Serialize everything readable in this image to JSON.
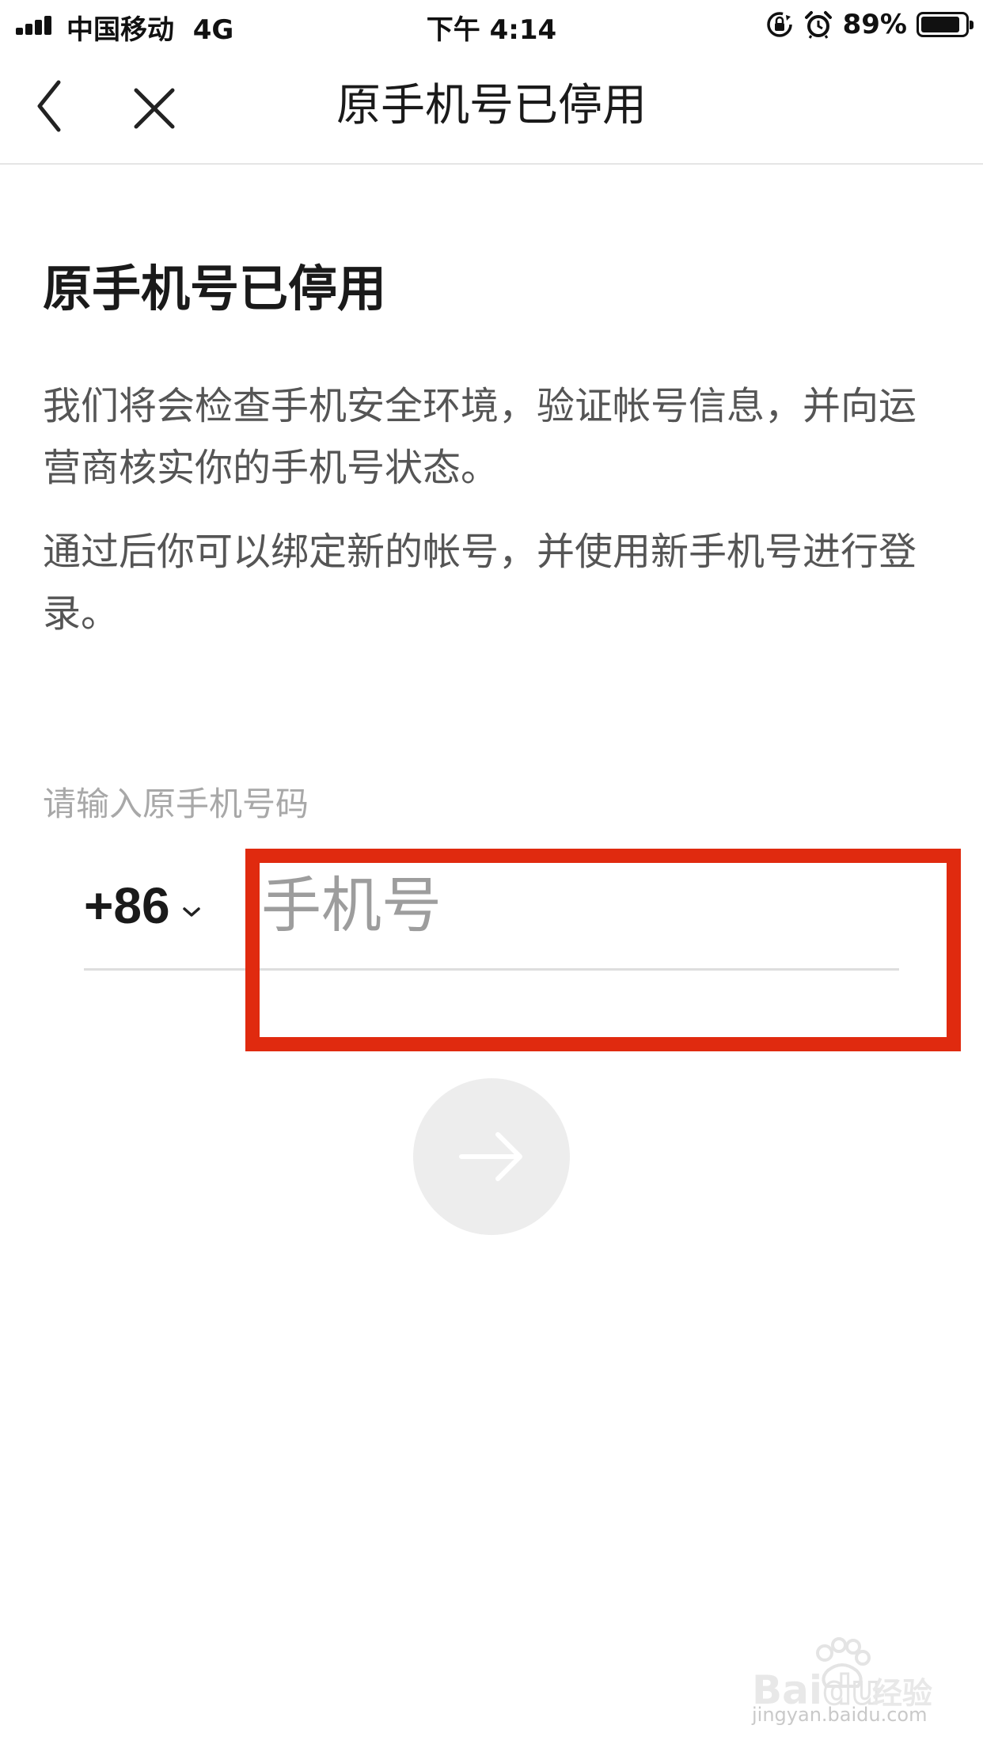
{
  "status_bar": {
    "carrier": "中国移动",
    "network": "4G",
    "time": "下午 4:14",
    "battery_percent": "89%",
    "battery_level": 0.89,
    "icons": [
      "signal-icon",
      "rotation-lock-icon",
      "alarm-icon",
      "battery-icon"
    ]
  },
  "nav": {
    "title": "原手机号已停用",
    "icons": [
      "back-chevron-icon",
      "close-icon"
    ]
  },
  "main": {
    "heading": "原手机号已停用",
    "paragraphs": [
      "我们将会检查手机安全环境，验证帐号信息，并向运营商核实你的手机号状态。",
      "通过后你可以绑定新的帐号，并使用新手机号进行登录。"
    ],
    "field_label": "请输入原手机号码",
    "country_code": "+86",
    "phone": {
      "value": "",
      "placeholder": "手机号"
    },
    "next_icon": "arrow-right-icon"
  },
  "annotation": {
    "color": "#e02a0f"
  },
  "colors": {
    "text_primary": "#1a1a1a",
    "text_secondary": "#555555",
    "label": "#a8a8a8",
    "placeholder": "#9d9d9d",
    "button_disabled": "#ededed",
    "arrow_disabled": "#ffffff"
  }
}
